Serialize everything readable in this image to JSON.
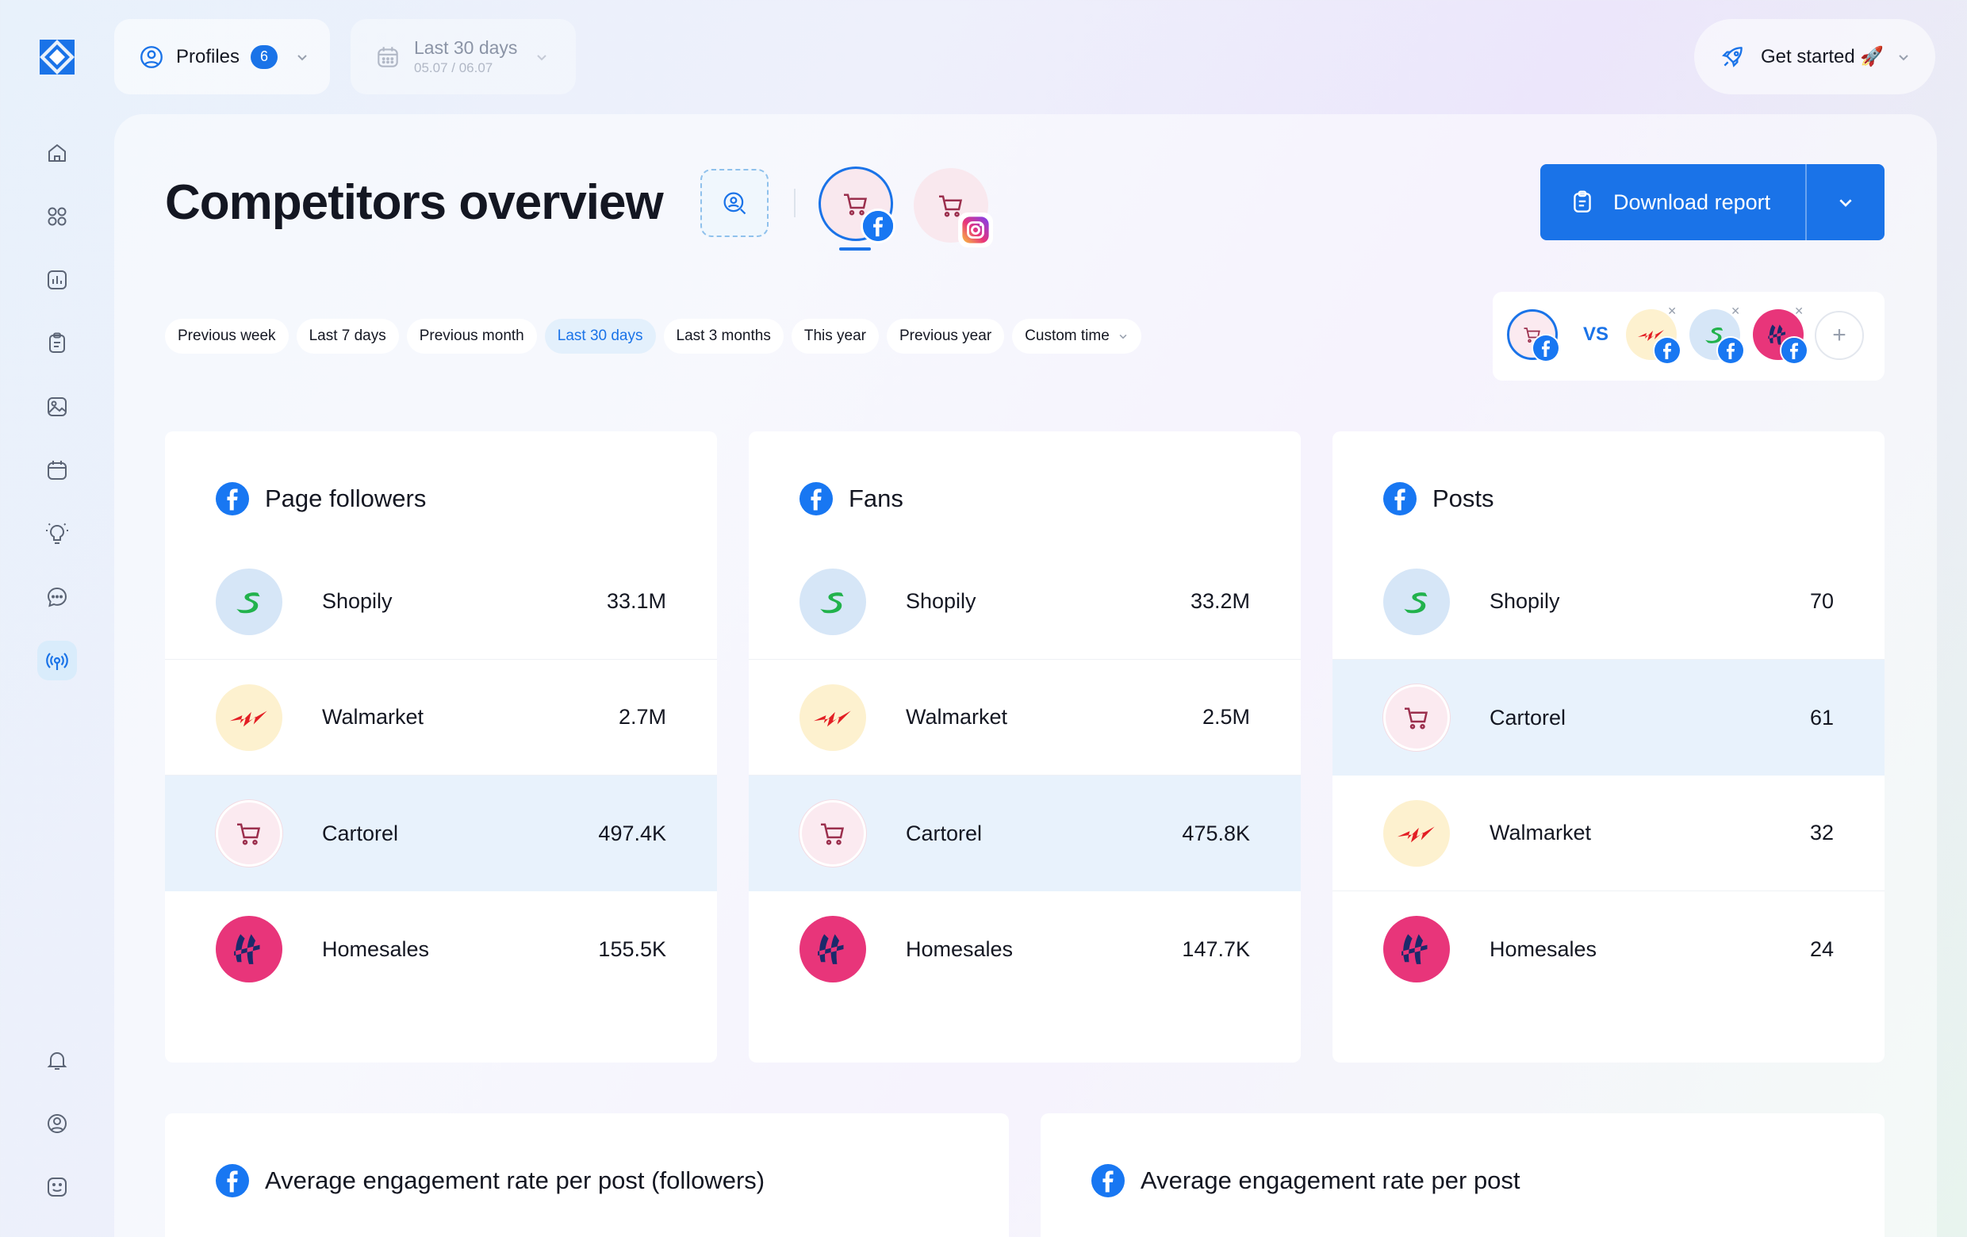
{
  "topbar": {
    "profiles_label": "Profiles",
    "profiles_count": "6",
    "date_label": "Last 30 days",
    "date_range": "05.07 / 06.07",
    "get_started_label": "Get started 🚀"
  },
  "sidebar": {
    "items": [
      "home-icon",
      "dashboard-icon",
      "analytics-icon",
      "reports-icon",
      "media-icon",
      "calendar-icon",
      "ideas-icon",
      "messages-icon",
      "competitors-icon",
      "notifications-icon",
      "account-icon",
      "feedback-icon"
    ]
  },
  "page": {
    "title": "Competitors overview",
    "download_label": "Download report"
  },
  "time_filters": [
    {
      "label": "Previous week",
      "active": false
    },
    {
      "label": "Last 7 days",
      "active": false
    },
    {
      "label": "Previous month",
      "active": false
    },
    {
      "label": "Last 30 days",
      "active": true
    },
    {
      "label": "Last 3 months",
      "active": false
    },
    {
      "label": "This year",
      "active": false
    },
    {
      "label": "Previous year",
      "active": false
    },
    {
      "label": "Custom time",
      "active": false
    }
  ],
  "vs": {
    "label": "VS"
  },
  "cards": [
    {
      "title": "Page followers",
      "rows": [
        {
          "brand": "Shopily",
          "value": "33.1M",
          "highlight": false
        },
        {
          "brand": "Walmarket",
          "value": "2.7M",
          "highlight": false
        },
        {
          "brand": "Cartorel",
          "value": "497.4K",
          "highlight": true
        },
        {
          "brand": "Homesales",
          "value": "155.5K",
          "highlight": false
        }
      ]
    },
    {
      "title": "Fans",
      "rows": [
        {
          "brand": "Shopily",
          "value": "33.2M",
          "highlight": false
        },
        {
          "brand": "Walmarket",
          "value": "2.5M",
          "highlight": false
        },
        {
          "brand": "Cartorel",
          "value": "475.8K",
          "highlight": true
        },
        {
          "brand": "Homesales",
          "value": "147.7K",
          "highlight": false
        }
      ]
    },
    {
      "title": "Posts",
      "rows": [
        {
          "brand": "Shopily",
          "value": "70",
          "highlight": false
        },
        {
          "brand": "Cartorel",
          "value": "61",
          "highlight": true
        },
        {
          "brand": "Walmarket",
          "value": "32",
          "highlight": false
        },
        {
          "brand": "Homesales",
          "value": "24",
          "highlight": false
        }
      ]
    }
  ],
  "bottom_cards": [
    {
      "title": "Average engagement rate per post (followers)"
    },
    {
      "title": "Average engagement rate per post"
    }
  ],
  "colors": {
    "accent": "#1a73e8",
    "facebook": "#1877f2",
    "highlight_row": "#e8f2fc",
    "homesales": "#e8357a",
    "walmarket_mark": "#e31e24",
    "shopily_mark": "#22b24c"
  }
}
